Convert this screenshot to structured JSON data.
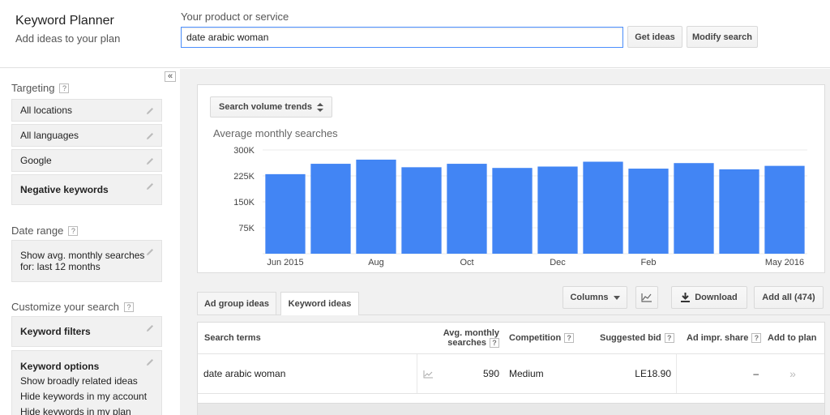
{
  "header": {
    "app_title": "Keyword Planner",
    "app_subtitle": "Add ideas to your plan",
    "product_label": "Your product or service",
    "search_value": "date arabic woman",
    "get_ideas_label": "Get ideas",
    "modify_search_label": "Modify search"
  },
  "sidebar": {
    "collapse_label": "«",
    "targeting_heading": "Targeting",
    "targeting_items": [
      "All locations",
      "All languages",
      "Google",
      "Negative keywords"
    ],
    "date_range_heading": "Date range",
    "date_range_text_line1": "Show avg. monthly searches",
    "date_range_text_line2": "for: last 12 months",
    "customize_heading": "Customize your search",
    "keyword_filters_label": "Keyword filters",
    "keyword_options_label": "Keyword options",
    "keyword_options_items": [
      "Show broadly related ideas",
      "Hide keywords in my account",
      "Hide keywords in my plan"
    ]
  },
  "chart_panel": {
    "trend_select_label": "Search volume trends",
    "chart_title": "Average monthly searches"
  },
  "chart_data": {
    "type": "bar",
    "title": "Average monthly searches",
    "categories": [
      "Jun 2015",
      "Jul",
      "Aug",
      "Sep",
      "Oct",
      "Nov",
      "Dec",
      "Jan",
      "Feb",
      "Mar",
      "Apr",
      "May 2016"
    ],
    "x_tick_labels": [
      "Jun 2015",
      "Aug",
      "Oct",
      "Dec",
      "Feb",
      "May 2016"
    ],
    "x_tick_indices": [
      0,
      2,
      4,
      6,
      8,
      11
    ],
    "values": [
      230000,
      260000,
      272000,
      250000,
      260000,
      248000,
      252000,
      266000,
      246000,
      262000,
      244000,
      254000
    ],
    "y_ticks": [
      300000,
      225000,
      150000,
      75000
    ],
    "y_tick_labels": [
      "300K",
      "225K",
      "150K",
      "75K"
    ],
    "ylim": [
      0,
      300000
    ],
    "grid": true,
    "bar_color": "#4285f4"
  },
  "tabs": {
    "ad_group_ideas": "Ad group ideas",
    "keyword_ideas": "Keyword ideas"
  },
  "toolbar": {
    "columns_label": "Columns",
    "download_label": "Download",
    "add_all_label": "Add all (474)"
  },
  "table": {
    "headers": {
      "search_terms": "Search terms",
      "avg_monthly_line1": "Avg. monthly",
      "avg_monthly_line2": "searches",
      "competition": "Competition",
      "suggested_bid": "Suggested bid",
      "ad_impr_share": "Ad impr. share",
      "add_to_plan": "Add to plan"
    },
    "rows": [
      {
        "term": "date arabic woman",
        "avg_monthly": "590",
        "competition": "Medium",
        "suggested_bid": "LE18.90",
        "ad_impr_share": "–",
        "add_to_plan": "»"
      }
    ]
  }
}
